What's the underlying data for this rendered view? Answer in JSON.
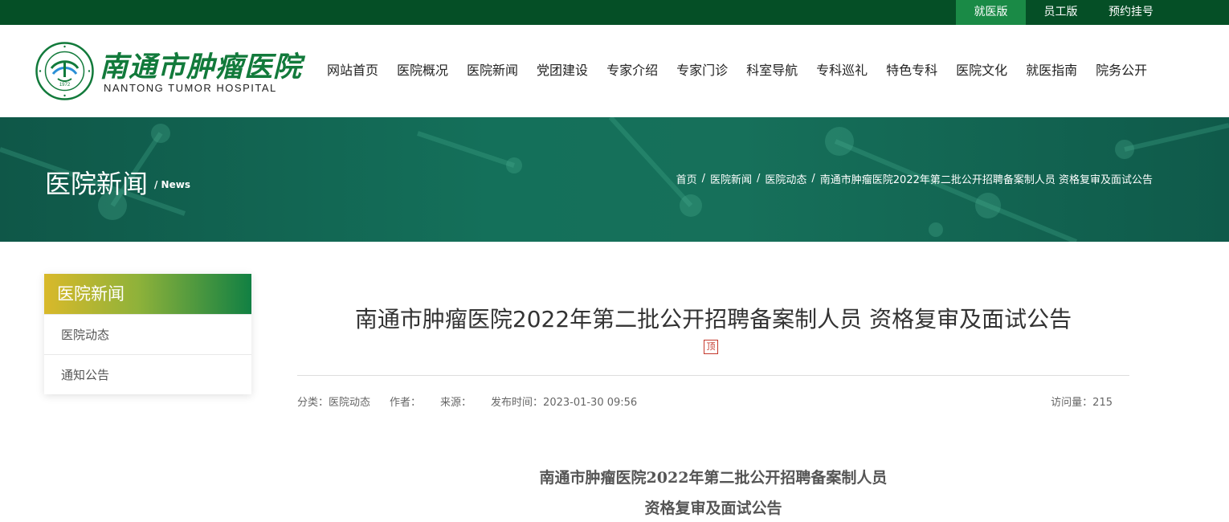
{
  "topbar": {
    "links": [
      "就医版",
      "员工版",
      "预约挂号"
    ]
  },
  "brand": {
    "name_cn": "南通市肿瘤医院",
    "name_en": "NANTONG TUMOR HOSPITAL",
    "emblem_year": "1972"
  },
  "nav": [
    "网站首页",
    "医院概况",
    "医院新闻",
    "党团建设",
    "专家介绍",
    "专家门诊",
    "科室导航",
    "专科巡礼",
    "特色专科",
    "医院文化",
    "就医指南",
    "院务公开"
  ],
  "banner": {
    "title": "医院新闻",
    "subtitle": "/ News",
    "breadcrumb": [
      "首页",
      "医院新闻",
      "医院动态",
      "南通市肿瘤医院2022年第二批公开招聘备案制人员 资格复审及面试公告"
    ],
    "separator": "/"
  },
  "sidebar": {
    "title": "医院新闻",
    "items": [
      "医院动态",
      "通知公告"
    ]
  },
  "article": {
    "title": "南通市肿瘤医院2022年第二批公开招聘备案制人员 资格复审及面试公告",
    "top_badge": "顶",
    "meta": {
      "category": "分类：医院动态",
      "author": "作者：",
      "source": "来源：",
      "published": "发布时间：2023-01-30 09:56",
      "views": "访问量：215"
    },
    "body_heading_line1": "南通市肿瘤医院2022年第二批公开招聘备案制人员",
    "body_heading_line2": "资格复审及面试公告"
  },
  "colors": {
    "topbar": "#054f26",
    "topbar_active": "#1a8a46",
    "brand_green": "#127a3b",
    "banner": "#14705a",
    "badge_red": "#c4382c"
  }
}
